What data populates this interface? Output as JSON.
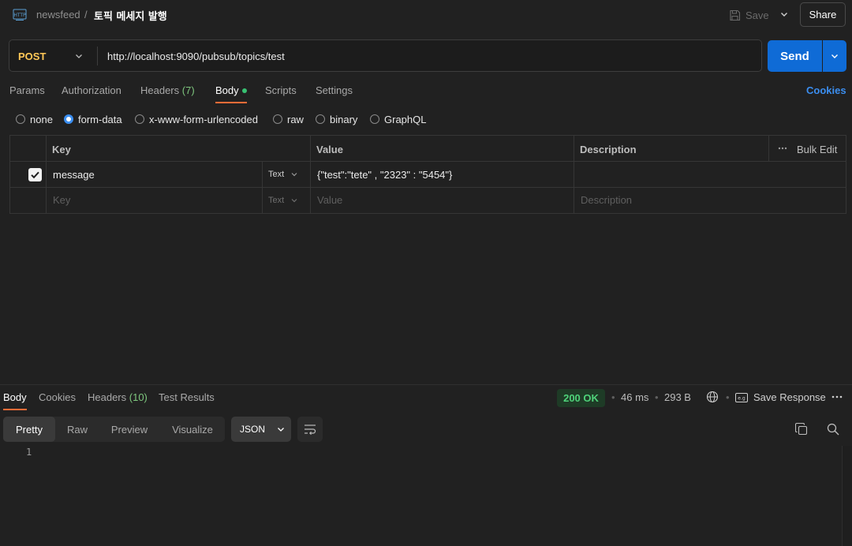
{
  "header": {
    "collection": "newsfeed",
    "separator": "/",
    "request_title": "토픽 메세지 발행",
    "save_label": "Save",
    "share_label": "Share"
  },
  "request": {
    "method": "POST",
    "url": "http://localhost:9090/pubsub/topics/test",
    "send_label": "Send"
  },
  "tabs": {
    "params": "Params",
    "authorization": "Authorization",
    "headers": "Headers",
    "headers_count": "(7)",
    "body": "Body",
    "scripts": "Scripts",
    "settings": "Settings",
    "cookies": "Cookies",
    "active": "Body"
  },
  "body_modes": {
    "none": "none",
    "form_data": "form-data",
    "urlencoded": "x-www-form-urlencoded",
    "raw": "raw",
    "binary": "binary",
    "graphql": "GraphQL",
    "selected": "form-data"
  },
  "form_table": {
    "col_key": "Key",
    "col_value": "Value",
    "col_description": "Description",
    "bulk_edit": "Bulk Edit",
    "rows": [
      {
        "checked": true,
        "key": "message",
        "type": "Text",
        "value": "{\"test\":\"tete\" , \"2323\" : \"5454\"}",
        "description": ""
      }
    ],
    "placeholder": {
      "key": "Key",
      "type": "Text",
      "value": "Value",
      "description": "Description"
    }
  },
  "response": {
    "tabs": {
      "body": "Body",
      "cookies": "Cookies",
      "headers": "Headers",
      "headers_count": "(10)",
      "test_results": "Test Results"
    },
    "status": "200 OK",
    "time": "46 ms",
    "size": "293 B",
    "save_response": "Save Response",
    "views": {
      "pretty": "Pretty",
      "raw": "Raw",
      "preview": "Preview",
      "visualize": "Visualize",
      "selected": "Pretty"
    },
    "format": "JSON",
    "line_number": "1"
  },
  "colors": {
    "accent_orange": "#ff6c37",
    "send_blue": "#0f6bd6",
    "method_yellow": "#ffc857",
    "status_green": "#4fd27a",
    "link_blue": "#3b8ef0"
  }
}
